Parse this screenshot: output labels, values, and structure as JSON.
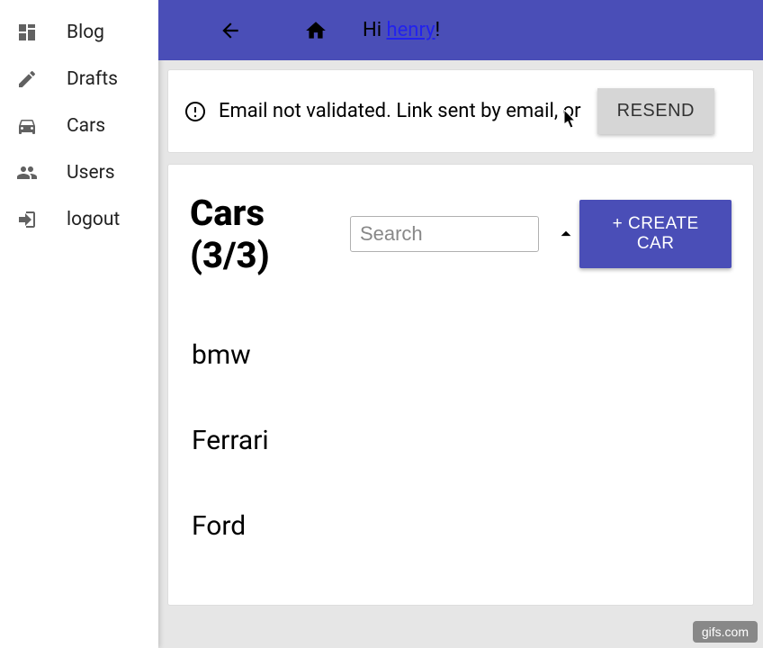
{
  "sidebar": {
    "items": [
      {
        "label": "Blog",
        "icon": "layout"
      },
      {
        "label": "Drafts",
        "icon": "pencil"
      },
      {
        "label": "Cars",
        "icon": "car"
      },
      {
        "label": "Users",
        "icon": "people"
      },
      {
        "label": "logout",
        "icon": "exit"
      }
    ]
  },
  "topbar": {
    "greeting_pre": "Hi ",
    "username": "henry",
    "greeting_post": "!"
  },
  "alert": {
    "text": "Email not validated. Link sent by email, or",
    "button": "RESEND"
  },
  "main": {
    "title": "Cars (3/3)",
    "search_placeholder": "Search",
    "create_label": "+ CREATE CAR",
    "cars": [
      {
        "name": "bmw"
      },
      {
        "name": "Ferrari"
      },
      {
        "name": "Ford"
      }
    ]
  },
  "watermark": "gifs.com"
}
